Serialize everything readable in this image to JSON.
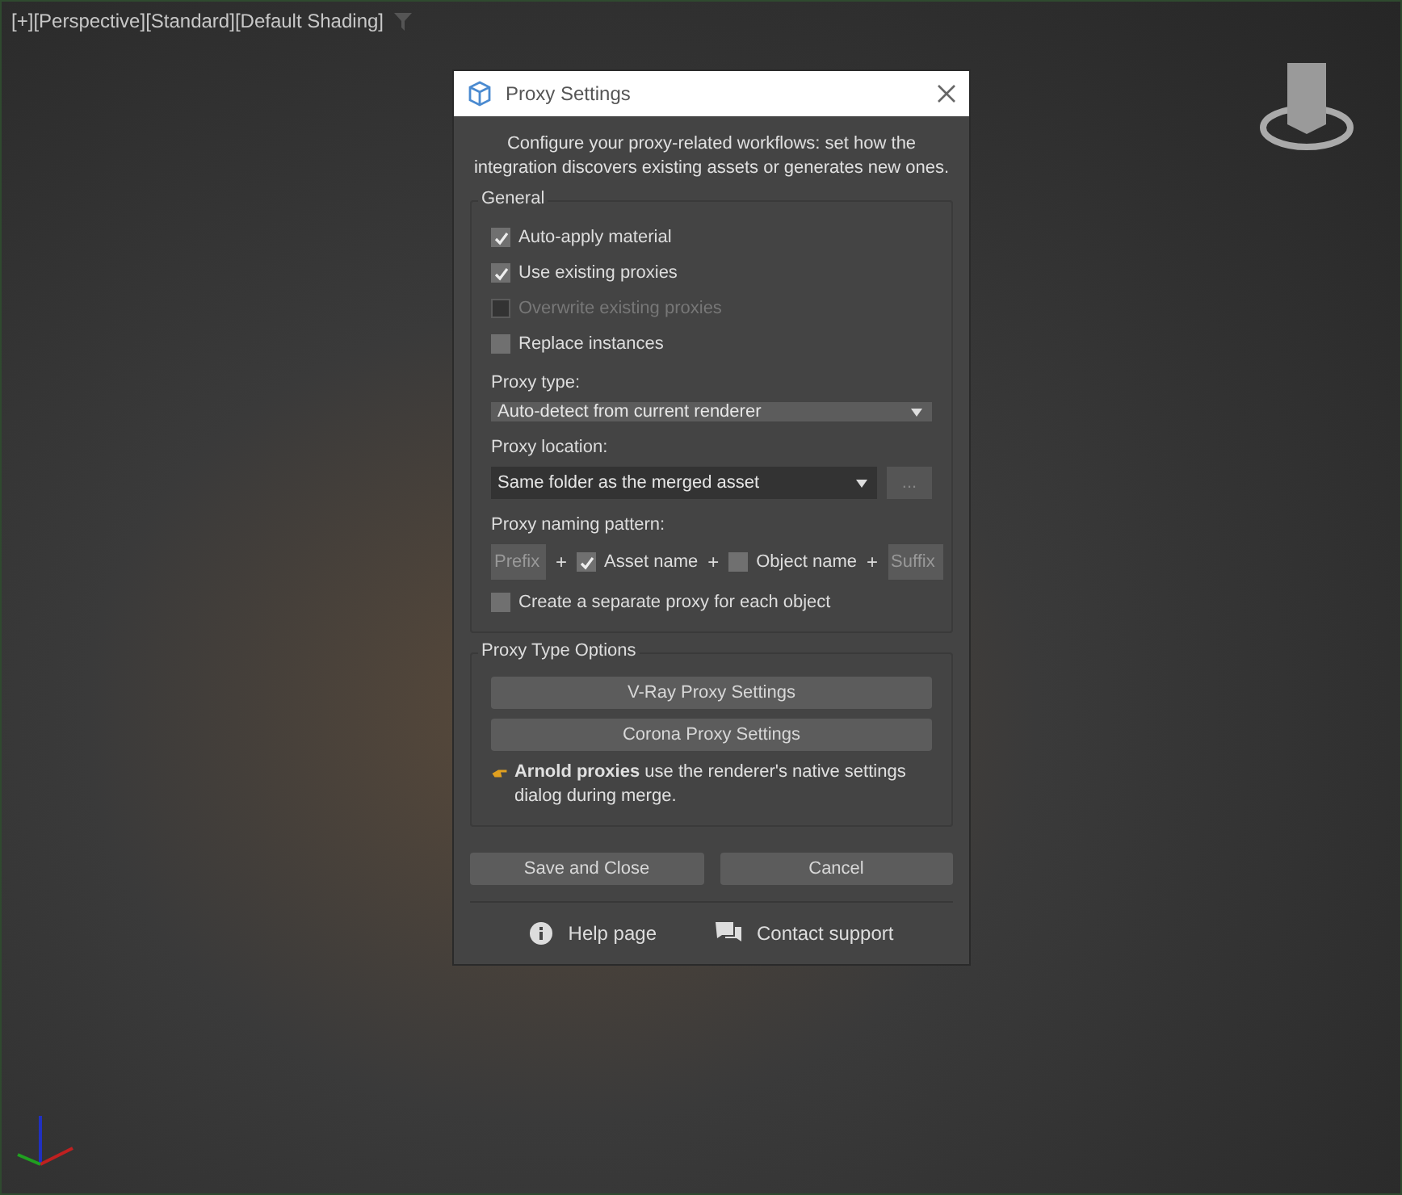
{
  "viewport": {
    "labels": [
      "[+]",
      "[Perspective]",
      "[Standard]",
      "[Default Shading]"
    ]
  },
  "dialog": {
    "title": "Proxy Settings",
    "description": "Configure your proxy-related workflows: set how the integration discovers existing assets or generates new ones.",
    "general": {
      "title": "General",
      "options": [
        {
          "label": "Auto-apply material",
          "checked": true,
          "disabled": false
        },
        {
          "label": "Use existing proxies",
          "checked": true,
          "disabled": false
        },
        {
          "label": "Overwrite existing proxies",
          "checked": false,
          "disabled": true
        },
        {
          "label": "Replace instances",
          "checked": false,
          "disabled": false
        }
      ],
      "proxy_type": {
        "label": "Proxy type:",
        "value": "Auto-detect from current renderer"
      },
      "proxy_location": {
        "label": "Proxy location:",
        "value": "Same folder as the merged asset",
        "browse": "..."
      },
      "naming": {
        "label": "Proxy naming pattern:",
        "parts": [
          {
            "kind": "field",
            "placeholder": "Prefix"
          },
          {
            "kind": "plus",
            "text": "+"
          },
          {
            "kind": "check",
            "label": "Asset name",
            "checked": true
          },
          {
            "kind": "plus",
            "text": "+"
          },
          {
            "kind": "check",
            "label": "Object name",
            "checked": false
          },
          {
            "kind": "plus",
            "text": "+"
          },
          {
            "kind": "field",
            "placeholder": "Suffix"
          }
        ]
      },
      "separate": {
        "label": "Create a separate proxy for each object",
        "checked": false
      }
    },
    "type_options": {
      "title": "Proxy Type Options",
      "buttons": [
        "V-Ray Proxy Settings",
        "Corona Proxy Settings"
      ],
      "note": "**Arnold proxies** use the renderer's native settings dialog during merge."
    },
    "buttons": [
      "Save and Close",
      "Cancel"
    ],
    "links": [
      {
        "kind": "help",
        "label": "Help page"
      },
      {
        "kind": "support",
        "label": "Contact support"
      }
    ]
  }
}
